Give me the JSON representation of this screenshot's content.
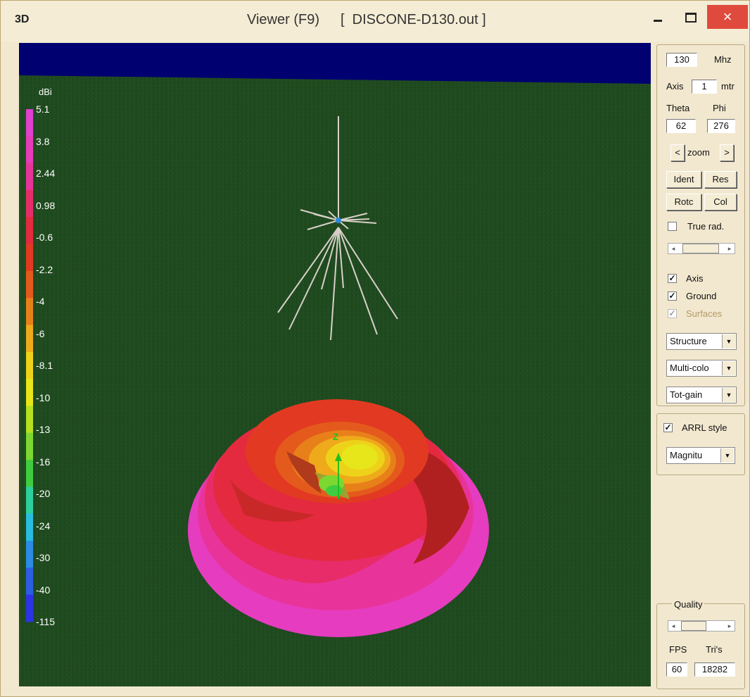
{
  "window": {
    "logo": "3D",
    "title_left": "Viewer (F9)",
    "title_right": "[  DISCONE-D130.out ]",
    "minimize": "–",
    "close": "×"
  },
  "scale": {
    "unit": "dBi",
    "labels": [
      "5.1",
      "3.8",
      "2.44",
      "0.98",
      "-0.6",
      "-2.2",
      "-4",
      "-6",
      "-8.1",
      "-10",
      "-13",
      "-16",
      "-20",
      "-24",
      "-30",
      "-40",
      "-115"
    ],
    "colors": [
      "#e040d0",
      "#e63cb8",
      "#e8349a",
      "#e82c6a",
      "#e42a3e",
      "#e23a22",
      "#e45a1c",
      "#e8801a",
      "#eeaa1a",
      "#eed21a",
      "#e6e61a",
      "#b4e01e",
      "#7cd830",
      "#40cc40",
      "#2cd0a0",
      "#28bce0",
      "#2c8ce4",
      "#2c5ee4",
      "#2c34e4"
    ]
  },
  "controls": {
    "frequency": "130",
    "frequency_unit": "Mhz",
    "axis_label": "Axis",
    "axis_value": "1",
    "axis_unit": "mtr",
    "theta_label": "Theta",
    "phi_label": "Phi",
    "theta": "62",
    "phi": "276",
    "zoom_label": "zoom",
    "zoom_prev": "<",
    "zoom_next": ">",
    "ident": "Ident",
    "res": "Res",
    "rotc": "Rotc",
    "col": "Col",
    "true_rad": "True rad.",
    "axis_chk": "Axis",
    "ground_chk": "Ground",
    "surfaces_chk": "Surfaces",
    "structure": "Structure",
    "multicolor": "Multi-colo",
    "totgain": "Tot-gain",
    "arrl": "ARRL style",
    "magnitude": "Magnitu",
    "quality": "Quality",
    "fps_label": "FPS",
    "tris_label": "Tri's",
    "fps": "60",
    "tris": "18282"
  },
  "viewport": {
    "axis_label": "Z"
  }
}
